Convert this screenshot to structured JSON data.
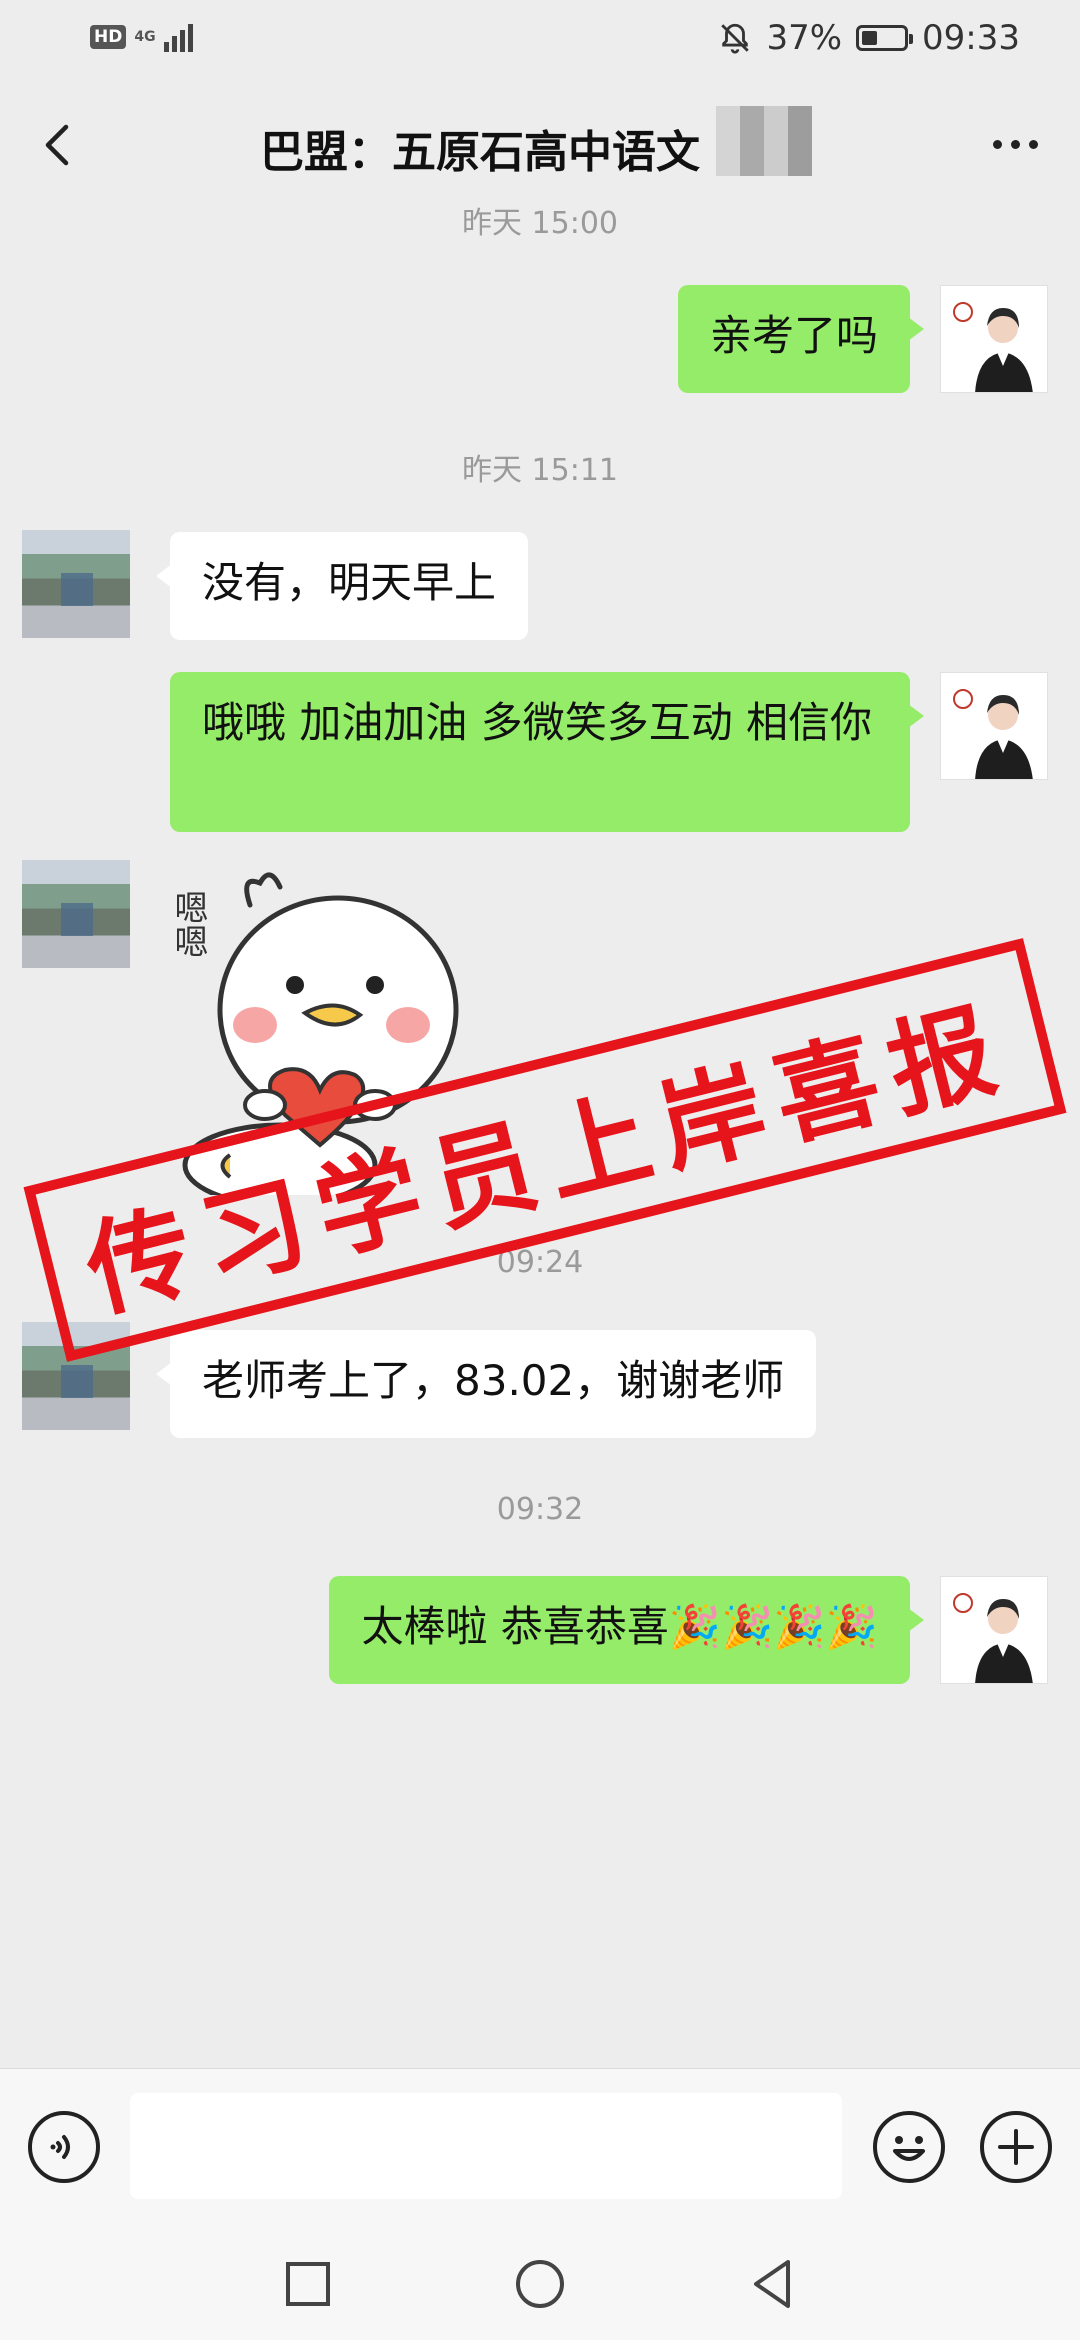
{
  "status_bar": {
    "hd": "HD",
    "network": "4G",
    "battery_percent": "37%",
    "battery_level": 0.37,
    "time": "09:33",
    "icons": [
      "signal-icon",
      "mute-bell-icon",
      "battery-icon"
    ]
  },
  "header": {
    "title": "巴盟：五原石高中语文",
    "back_icon": "chevron-left-icon",
    "more_icon": "more-dots-icon"
  },
  "messages": [
    {
      "type": "timestamp",
      "text": "昨天 15:00"
    },
    {
      "type": "sent",
      "text": "亲考了吗"
    },
    {
      "type": "timestamp",
      "text": "昨天 15:11"
    },
    {
      "type": "received",
      "text": "没有，明天早上"
    },
    {
      "type": "sent",
      "text": "哦哦  加油加油  多微笑多互动  相信你"
    },
    {
      "type": "received_sticker",
      "text": "嗯嗯"
    },
    {
      "type": "timestamp",
      "text": "09:24"
    },
    {
      "type": "received",
      "text": "老师考上了，83.02，谢谢老师"
    },
    {
      "type": "timestamp",
      "text": "09:32"
    },
    {
      "type": "sent",
      "text": "太棒啦  恭喜恭喜🎉🎉🎉🎉"
    }
  ],
  "overlay_stamp": {
    "text": "传习学员上岸喜报",
    "color": "#e6141b"
  },
  "input_bar": {
    "icons": [
      "voice-icon",
      "emoji-icon",
      "plus-icon"
    ]
  },
  "nav_bar": {
    "icons": [
      "recent-apps-icon",
      "home-icon",
      "back-triangle-icon"
    ]
  },
  "colors": {
    "sent_bubble": "#95ec69",
    "received_bubble": "#ffffff",
    "background": "#ededed"
  }
}
